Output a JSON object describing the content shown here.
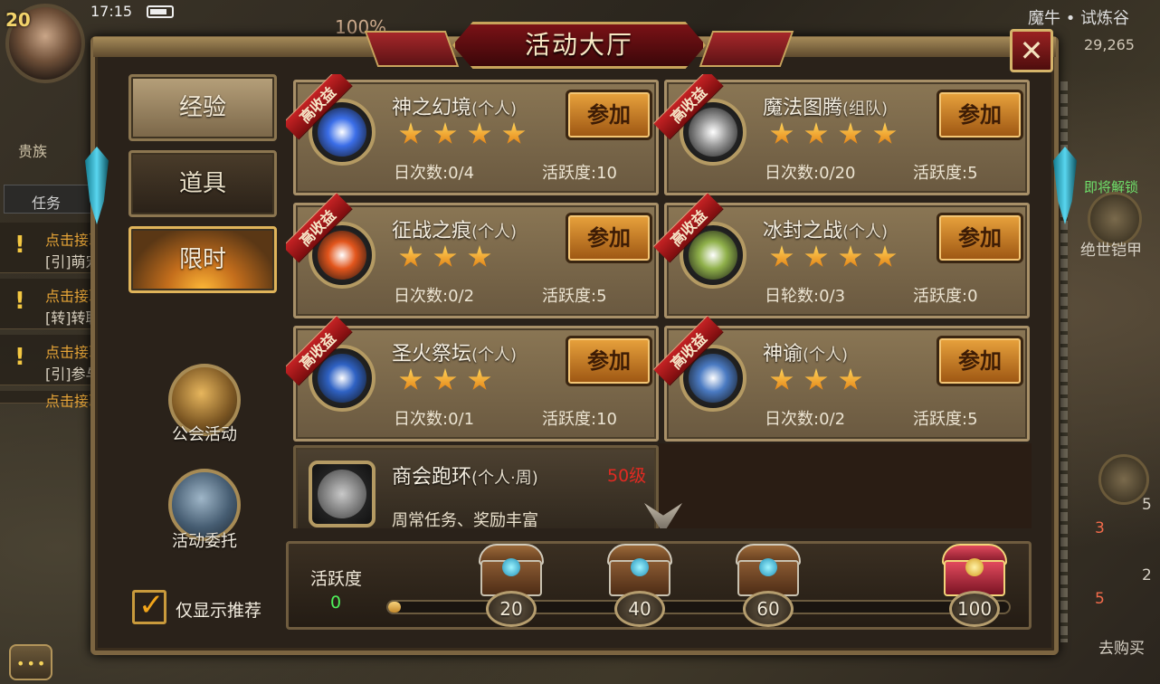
{
  "hud": {
    "level": "20",
    "time": "17:15",
    "hp_percent": "100%",
    "location": "魔牛 • 试炼谷",
    "coords": "29,265",
    "noble_label": "贵族",
    "task_tab": "任务",
    "tasks": [
      {
        "title": "点击接取",
        "sub": "[引]萌宠"
      },
      {
        "title": "点击接取",
        "sub": "[转]转职"
      },
      {
        "title": "点击接取",
        "sub": "[引]参与"
      },
      {
        "title": "点击接取",
        "sub": ""
      }
    ],
    "unlock_label": "即将解锁",
    "armor_label": "绝世铠甲",
    "right_counts": [
      "5",
      "3",
      "2",
      "5"
    ],
    "buy_label": "去购买",
    "more_label": "•••"
  },
  "dialog": {
    "title": "活动大厅",
    "close": "✕",
    "tabs": [
      "经验",
      "道具",
      "限时"
    ],
    "side": [
      {
        "label": "公会活动",
        "icon": "guild-horn-icon"
      },
      {
        "label": "活动委托",
        "icon": "commission-icon"
      }
    ],
    "checkbox": {
      "label": "仅显示推荐",
      "checked": true,
      "mark": "✓"
    },
    "ribbon_text": "高收益",
    "join_label": "参加",
    "activities": [
      {
        "name": "神之幻境",
        "mode": "(个人)",
        "stars": 4,
        "count_label": "日次数:",
        "count": "0/4",
        "activity_label": "活跃度:",
        "activity": "10",
        "icon": "portal-icon",
        "icon_color": "#3b6ee8"
      },
      {
        "name": "魔法图腾",
        "mode": "(组队)",
        "stars": 4,
        "count_label": "日次数:",
        "count": "0/20",
        "activity_label": "活跃度:",
        "activity": "5",
        "icon": "totem-icon",
        "icon_color": "#9a9a9a"
      },
      {
        "name": "征战之痕",
        "mode": "(个人)",
        "stars": 3,
        "count_label": "日次数:",
        "count": "0/2",
        "activity_label": "活跃度:",
        "activity": "5",
        "icon": "torch-icon",
        "icon_color": "#e2551c"
      },
      {
        "name": "冰封之战",
        "mode": "(个人)",
        "stars": 4,
        "count_label": "日轮数:",
        "count": "0/3",
        "activity_label": "活跃度:",
        "activity": "0",
        "icon": "swords-icon",
        "icon_color": "#8fb04a"
      },
      {
        "name": "圣火祭坛",
        "mode": "(个人)",
        "stars": 3,
        "count_label": "日次数:",
        "count": "0/1",
        "activity_label": "活跃度:",
        "activity": "10",
        "icon": "chalice-icon",
        "icon_color": "#2f62c4"
      },
      {
        "name": "神谕",
        "mode": "(个人)",
        "stars": 3,
        "count_label": "日次数:",
        "count": "0/2",
        "activity_label": "活跃度:",
        "activity": "5",
        "icon": "scroll-icon",
        "icon_color": "#4a7ac2"
      }
    ],
    "locked": {
      "name": "商会跑环",
      "mode": "(个人·周)",
      "level": "50级",
      "desc": "周常任务、奖励丰富",
      "icon": "shield-icon"
    },
    "activity_bar": {
      "label": "活跃度",
      "value": "0",
      "progress": 0.02,
      "milestones": [
        {
          "value": "20",
          "chest": "blue"
        },
        {
          "value": "40",
          "chest": "blue"
        },
        {
          "value": "60",
          "chest": "blue"
        },
        {
          "value": "100",
          "chest": "gold"
        }
      ]
    }
  }
}
